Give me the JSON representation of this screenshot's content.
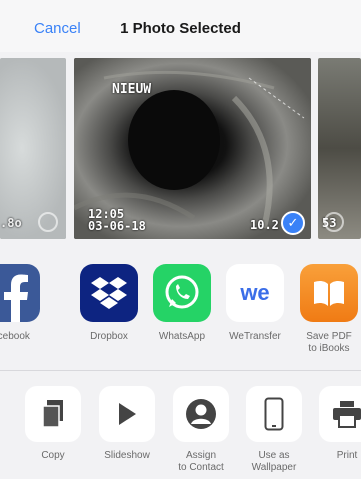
{
  "header": {
    "cancel_label": "Cancel",
    "title": "1 Photo Selected"
  },
  "photos": {
    "left_overlay": ".8o",
    "main_label": "NIEUW",
    "main_time": "12:05",
    "main_date": "03-06-18",
    "main_counter": "10.2",
    "right_overlay": "53"
  },
  "share_apps": [
    {
      "label": "acebook",
      "icon": "facebook-icon",
      "color": "#3b5998"
    },
    {
      "label": "Dropbox",
      "icon": "dropbox-icon",
      "color": "#0d2481"
    },
    {
      "label": "WhatsApp",
      "icon": "whatsapp-icon",
      "color": "#25d366"
    },
    {
      "label": "WeTransfer",
      "icon": "wetransfer-icon",
      "color": "#ffffff"
    },
    {
      "label": "Save PDF\nto iBooks",
      "icon": "ibooks-icon",
      "color": "#f58a1f"
    }
  ],
  "actions": [
    {
      "label": "Copy",
      "icon": "copy-icon"
    },
    {
      "label": "Slideshow",
      "icon": "slideshow-icon"
    },
    {
      "label": "Assign\nto Contact",
      "icon": "contact-icon"
    },
    {
      "label": "Use as\nWallpaper",
      "icon": "wallpaper-icon"
    },
    {
      "label": "Print",
      "icon": "print-icon"
    }
  ],
  "colors": {
    "accent": "#3a82f7",
    "background": "#f2f2f4"
  }
}
